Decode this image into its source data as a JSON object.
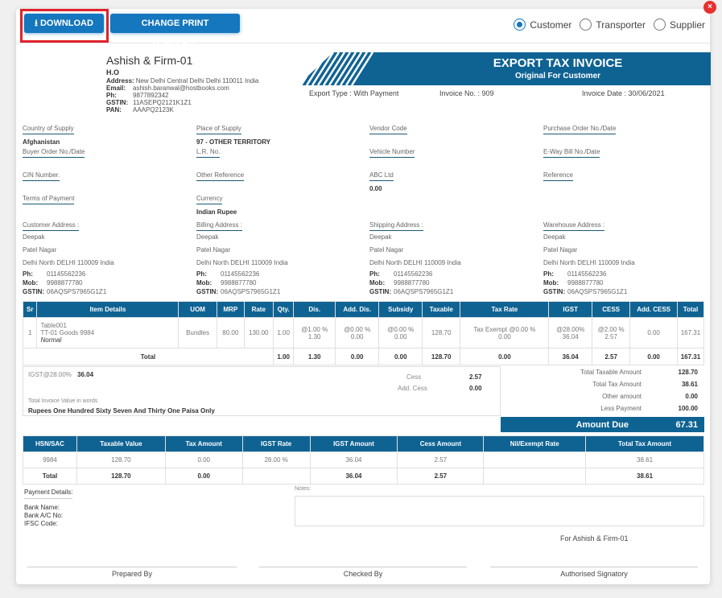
{
  "toolbar": {
    "download_label": "DOWNLOAD",
    "download_icon": "download-icon",
    "template_label": "CHANGE PRINT TEMPLATE",
    "close_icon": "×",
    "copy_options": [
      {
        "label": "Customer",
        "checked": true
      },
      {
        "label": "Transporter",
        "checked": false
      },
      {
        "label": "Supplier",
        "checked": false
      }
    ]
  },
  "firm": {
    "name": "Ashish & Firm-01",
    "branch": "H.O",
    "address_label": "Address:",
    "address": "New Delhi Central Delhi Delhi 110011 India",
    "email_label": "Email:",
    "email": "ashish.baranwal@hostbooks.com",
    "ph_label": "Ph:",
    "ph": "9877892342",
    "gstin_label": "GSTIN:",
    "gstin": "11ASEPQ2121K1Z1",
    "pan_label": "PAN:",
    "pan": "AAAPQ2123K"
  },
  "invoice": {
    "title": "EXPORT TAX INVOICE",
    "subtitle": "Original For Customer",
    "export_type": "Export Type : With Payment",
    "invoice_no": "Invoice No. : 909",
    "invoice_date": "Invoice Date : 30/06/2021",
    "accent_color": "#0f6393"
  },
  "fields": {
    "country_of_supply": {
      "label": "Country of Supply",
      "value": "Afghanistan"
    },
    "place_of_supply": {
      "label": "Place of Supply",
      "value": "97 - OTHER TERRITORY"
    },
    "vendor_code": {
      "label": "Vendor Code",
      "value": ""
    },
    "purchase_order": {
      "label": "Purchase Order No./Date",
      "value": ""
    },
    "buyer_order": {
      "label": "Buyer Order No./Date",
      "value": ""
    },
    "lr_no": {
      "label": "L.R. No.",
      "value": ""
    },
    "vehicle_number": {
      "label": "Vehicle Number",
      "value": ""
    },
    "eway_bill": {
      "label": "E-Way Bill No./Date",
      "value": ""
    },
    "cin_number": {
      "label": "CIN Number.",
      "value": ""
    },
    "other_reference": {
      "label": "Other Reference",
      "value": ""
    },
    "abc_ltd": {
      "label": "ABC Ltd",
      "value": "0.00"
    },
    "reference": {
      "label": "Reference",
      "value": ""
    },
    "terms_of_payment": {
      "label": "Terms of Payment",
      "value": ""
    },
    "currency": {
      "label": "Currency",
      "value": "Indian Rupee"
    }
  },
  "addresses": [
    {
      "label": "Customer Address :",
      "name": "Deepak",
      "line1": "Patel Nagar",
      "line2": "Delhi North DELHI 110009 India",
      "ph_label": "Ph:",
      "ph": "01145562236",
      "mob_label": "Mob:",
      "mob": "9988877780",
      "gstin_label": "GSTIN:",
      "gstin": "06AQSPS7965G1Z1"
    },
    {
      "label": "Billing Address :",
      "name": "Deepak",
      "line1": "Patel Nagar",
      "line2": "Delhi North DELHI 110009 India",
      "ph_label": "Ph:",
      "ph": "01145562236",
      "mob_label": "Mob:",
      "mob": "9988877780",
      "gstin_label": "GSTIN:",
      "gstin": "06AQSPS7965G1Z1"
    },
    {
      "label": "Shipping Address :",
      "name": "Deepak",
      "line1": "Patel Nagar",
      "line2": "Delhi North DELHI 110009 India",
      "ph_label": "Ph:",
      "ph": "01145562236",
      "mob_label": "Mob:",
      "mob": "9988877780",
      "gstin_label": "GSTIN:",
      "gstin": "06AQSPS7965G1Z1"
    },
    {
      "label": "Warehouse Address :",
      "name": "Deepak",
      "line1": "Patel Nagar",
      "line2": "Delhi North DELHI 110009 India",
      "ph_label": "Ph:",
      "ph": "01145562236",
      "mob_label": "Mob:",
      "mob": "9988877780",
      "gstin_label": "GSTIN:",
      "gstin": "06AQSPS7965G1Z1"
    }
  ],
  "items_table": {
    "headers": [
      "Sr",
      "Item Details",
      "UOM",
      "MRP",
      "Rate",
      "Qty.",
      "Dis.",
      "Add. Dis.",
      "Subsidy",
      "Taxable",
      "Tax Rate",
      "IGST",
      "CESS",
      "Add. CESS",
      "Total"
    ],
    "rows": [
      {
        "sr": "1",
        "item_line1": "Table001",
        "item_line2": "TT-01 Goods 9984",
        "item_line3": "Normal",
        "uom": "Bundles",
        "mrp": "80.00",
        "rate": "130.00",
        "qty": "1.00",
        "dis_rate": "@1.00 %",
        "dis": "1.30",
        "add_dis_rate": "@0.00 %",
        "add_dis": "0.00",
        "subsidy_rate": "@0.00 %",
        "subsidy": "0.00",
        "taxable": "128.70",
        "tax_rate_label": "Tax Exempt @0.00 %",
        "tax_rate": "0.00",
        "igst_rate": "@28.00%",
        "igst": "36.04",
        "cess_rate": "@2.00 %",
        "cess": "2.57",
        "add_cess": "0.00",
        "total": "167.31"
      }
    ],
    "total": {
      "label": "Total",
      "qty": "1.00",
      "dis": "1.30",
      "add_dis": "0.00",
      "subsidy": "0.00",
      "taxable": "128.70",
      "tax_rate": "0.00",
      "igst": "36.04",
      "cess": "2.57",
      "add_cess": "0.00",
      "total": "167.31"
    }
  },
  "summary": {
    "igst_label": "IGST@28.00%",
    "igst_value": "36.04",
    "cess_label": "Cess",
    "cess_value": "2.57",
    "add_cess_label": "Add. Cess",
    "add_cess_value": "0.00",
    "words_label": "Total Invoice Value in words",
    "words_value": "Rupees One Hundred Sixty Seven And Thirty One Paisa Only",
    "totals": [
      {
        "label": "Total Taxable Amount",
        "value": "128.70"
      },
      {
        "label": "Total Tax Amount",
        "value": "38.61"
      },
      {
        "label": "Other amount",
        "value": "0.00"
      },
      {
        "label": "Less Payment",
        "value": "100.00"
      }
    ],
    "amount_due_label": "Amount Due",
    "amount_due_value": "67.31"
  },
  "hsn_table": {
    "headers": [
      "HSN/SAC",
      "Taxable Value",
      "Tax Amount",
      "IGST Rate",
      "IGST Amount",
      "Cess Amount",
      "Nil/Exempt Rate",
      "Total Tax Amount"
    ],
    "rows": [
      [
        "9984",
        "128.70",
        "0.00",
        "28.00 %",
        "36.04",
        "2.57",
        "",
        "38.61"
      ]
    ],
    "total": [
      "Total",
      "128.70",
      "0.00",
      "",
      "36.04",
      "2.57",
      "",
      "38.61"
    ]
  },
  "footer": {
    "payment_title": "Payment Details:",
    "bank_name": "Bank Name:",
    "bank_ac": "Bank A/C No:",
    "ifsc": "IFSC Code:",
    "notes_label": "Notes:",
    "notes_value": "",
    "for_firm": "For Ashish & Firm-01",
    "prepared_by": "Prepared By",
    "checked_by": "Checked By",
    "authorised": "Authorised Signatory"
  }
}
